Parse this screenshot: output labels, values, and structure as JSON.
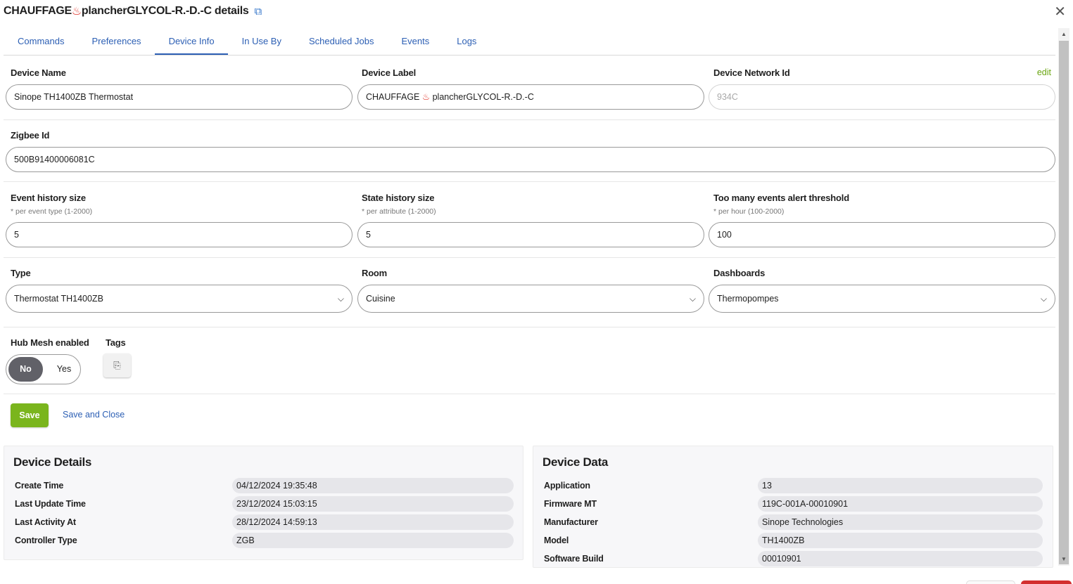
{
  "dialog": {
    "title_prefix": "CHAUFFAGE",
    "title_suffix": "plancherGLYCOL-R.-D.-C details",
    "flame_glyph": "♨",
    "external_glyph": "⧉",
    "close_glyph": "✕"
  },
  "tabs": [
    {
      "label": "Commands"
    },
    {
      "label": "Preferences"
    },
    {
      "label": "Device Info"
    },
    {
      "label": "In Use By"
    },
    {
      "label": "Scheduled Jobs"
    },
    {
      "label": "Events"
    },
    {
      "label": "Logs"
    }
  ],
  "form": {
    "device_name": {
      "label": "Device Name",
      "value": "Sinope TH1400ZB Thermostat"
    },
    "device_label": {
      "label": "Device Label",
      "value_prefix": "CHAUFFAGE",
      "value_suffix": "plancherGLYCOL-R.-D.-C"
    },
    "device_network_id": {
      "label": "Device Network Id",
      "value": "934C",
      "edit_label": "edit"
    },
    "zigbee_id": {
      "label": "Zigbee Id",
      "value": "500B91400006081C"
    },
    "event_history": {
      "label": "Event history size",
      "hint": "* per event type (1-2000)",
      "value": "5"
    },
    "state_history": {
      "label": "State history size",
      "hint": "* per attribute (1-2000)",
      "value": "5"
    },
    "alert_threshold": {
      "label": "Too many events alert threshold",
      "hint": "* per hour (100-2000)",
      "value": "100"
    },
    "type": {
      "label": "Type",
      "value": "Thermostat TH1400ZB"
    },
    "room": {
      "label": "Room",
      "value": "Cuisine"
    },
    "dashboards": {
      "label": "Dashboards",
      "value": "Thermopompes"
    },
    "hub_mesh": {
      "label": "Hub Mesh enabled",
      "no": "No",
      "yes": "Yes",
      "selected": "No"
    },
    "tags": {
      "label": "Tags",
      "icon_glyph": "⎘"
    },
    "chevron_glyph": "⌵"
  },
  "actions": {
    "save_label": "Save",
    "save_close_label": "Save and Close"
  },
  "device_details": {
    "title": "Device Details",
    "rows": [
      {
        "key": "Create Time",
        "value": "04/12/2024 19:35:48"
      },
      {
        "key": "Last Update Time",
        "value": "23/12/2024 15:03:15"
      },
      {
        "key": "Last Activity At",
        "value": "28/12/2024 14:59:13"
      },
      {
        "key": "Controller Type",
        "value": "ZGB"
      }
    ]
  },
  "device_data": {
    "title": "Device Data",
    "rows": [
      {
        "key": "Application",
        "value": "13"
      },
      {
        "key": "Firmware MT",
        "value": "119C-001A-00010901"
      },
      {
        "key": "Manufacturer",
        "value": "Sinope Technologies"
      },
      {
        "key": "Model",
        "value": "TH1400ZB"
      },
      {
        "key": "Software Build",
        "value": "00010901"
      }
    ]
  },
  "scrollbar": {
    "up_glyph": "▲",
    "down_glyph": "▼"
  }
}
